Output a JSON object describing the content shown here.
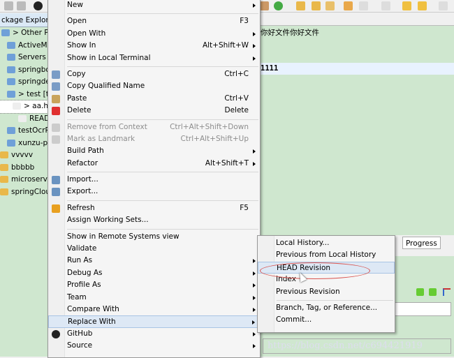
{
  "explorer": {
    "title": "ckage Explorer",
    "items": [
      {
        "label": "> Other Proje",
        "icon": "folder-icon"
      },
      {
        "label": "ActiveMqA",
        "icon": "folder-icon"
      },
      {
        "label": "Servers",
        "icon": "folder-icon"
      },
      {
        "label": "springboc",
        "icon": "folder-icon"
      },
      {
        "label": "springdem",
        "icon": "folder-icon"
      },
      {
        "label": "> test [tes",
        "icon": "git-folder-icon"
      },
      {
        "label": "> aa.ht",
        "icon": "file-icon"
      },
      {
        "label": "READM",
        "icon": "file-icon"
      },
      {
        "label": "testOcrPro",
        "icon": "folder-icon"
      },
      {
        "label": "xunzu-proj",
        "icon": "project-icon"
      },
      {
        "label": "vvvvv",
        "icon": "folder-icon"
      },
      {
        "label": "bbbbb",
        "icon": "folder-icon"
      },
      {
        "label": "microservice-",
        "icon": "folder-icon"
      },
      {
        "label": "springClound",
        "icon": "folder-icon"
      }
    ]
  },
  "editor": {
    "lines": [
      "你好文件你好文件",
      "",
      "",
      "1111"
    ]
  },
  "lower": {
    "progress_tab": "Progress",
    "watermark": "https://blog.csdn.net/c694421919"
  },
  "menu": [
    {
      "label": "New",
      "submenu": true
    },
    {
      "sep": true
    },
    {
      "label": "Open",
      "shortcut": "F3"
    },
    {
      "label": "Open With",
      "submenu": true
    },
    {
      "label": "Show In",
      "shortcut": "Alt+Shift+W",
      "submenu": true
    },
    {
      "label": "Show in Local Terminal",
      "submenu": true
    },
    {
      "sep": true
    },
    {
      "label": "Copy",
      "shortcut": "Ctrl+C",
      "icon": "copy-icon"
    },
    {
      "label": "Copy Qualified Name",
      "icon": "copy-qualified-icon"
    },
    {
      "label": "Paste",
      "shortcut": "Ctrl+V",
      "icon": "paste-icon"
    },
    {
      "label": "Delete",
      "shortcut": "Delete",
      "icon": "delete-icon"
    },
    {
      "sep": true
    },
    {
      "label": "Remove from Context",
      "shortcut": "Ctrl+Alt+Shift+Down",
      "disabled": true,
      "icon": "remove-context-icon"
    },
    {
      "label": "Mark as Landmark",
      "shortcut": "Ctrl+Alt+Shift+Up",
      "disabled": true,
      "icon": "landmark-icon"
    },
    {
      "label": "Build Path",
      "submenu": true
    },
    {
      "label": "Refactor",
      "shortcut": "Alt+Shift+T",
      "submenu": true
    },
    {
      "sep": true
    },
    {
      "label": "Import...",
      "icon": "import-icon"
    },
    {
      "label": "Export...",
      "icon": "export-icon"
    },
    {
      "sep": true
    },
    {
      "label": "Refresh",
      "shortcut": "F5",
      "icon": "refresh-icon"
    },
    {
      "label": "Assign Working Sets..."
    },
    {
      "sep": true
    },
    {
      "label": "Show in Remote Systems view"
    },
    {
      "label": "Validate"
    },
    {
      "label": "Run As",
      "submenu": true
    },
    {
      "label": "Debug As",
      "submenu": true
    },
    {
      "label": "Profile As",
      "submenu": true
    },
    {
      "label": "Team",
      "submenu": true
    },
    {
      "label": "Compare With",
      "submenu": true
    },
    {
      "label": "Replace With",
      "submenu": true,
      "highlighted": true
    },
    {
      "label": "GitHub",
      "submenu": true,
      "icon": "github-icon"
    },
    {
      "label": "Source",
      "submenu": true
    }
  ],
  "submenu": [
    {
      "label": "Local History..."
    },
    {
      "label": "Previous from Local History"
    },
    {
      "label": "HEAD Revision",
      "highlighted": true
    },
    {
      "label": "Index"
    },
    {
      "label": "Previous Revision"
    },
    {
      "sep": true
    },
    {
      "label": "Branch, Tag, or Reference..."
    },
    {
      "label": "Commit..."
    }
  ],
  "colors": {
    "highlight": "#dde8f5",
    "annotation": "#d9534f",
    "editor_bg": "#cfe7cf"
  }
}
